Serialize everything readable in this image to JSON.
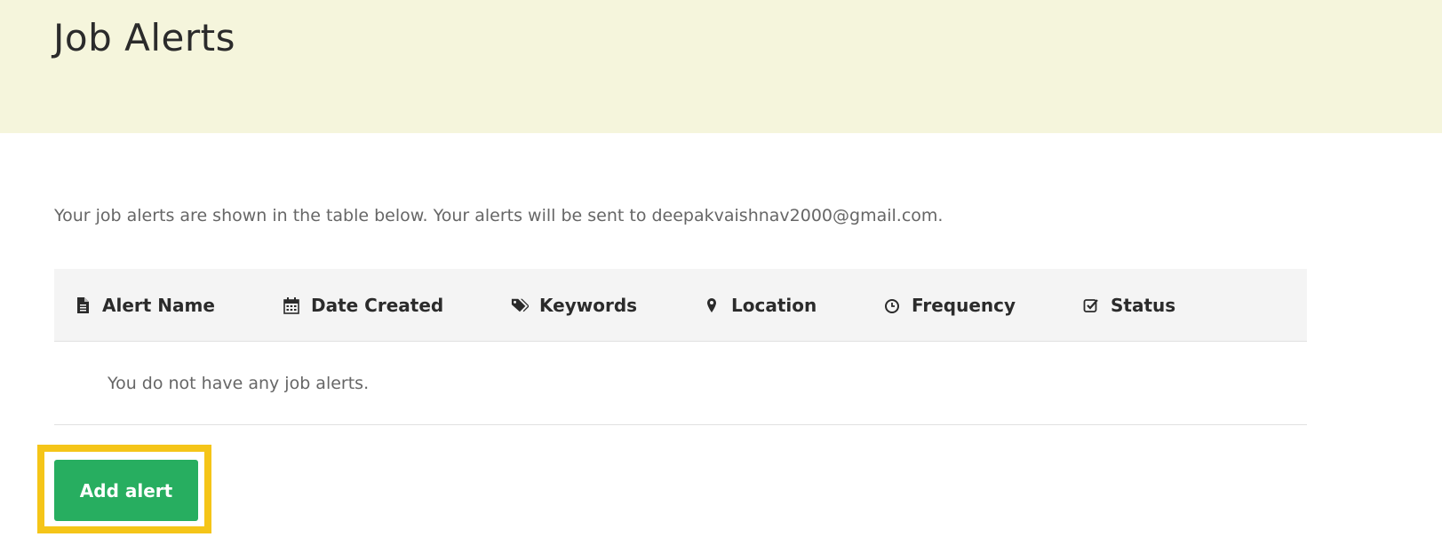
{
  "header": {
    "title": "Job Alerts",
    "background": "#f5f5dc"
  },
  "intro_text": "Your job alerts are shown in the table below. Your alerts will be sent to deepakvaishnav2000@gmail.com.",
  "table": {
    "columns": [
      {
        "label": "Alert Name",
        "icon": "file-text-icon"
      },
      {
        "label": "Date Created",
        "icon": "calendar-icon"
      },
      {
        "label": "Keywords",
        "icon": "tags-icon"
      },
      {
        "label": "Location",
        "icon": "map-pin-icon"
      },
      {
        "label": "Frequency",
        "icon": "clock-icon"
      },
      {
        "label": "Status",
        "icon": "checkbox-icon"
      }
    ],
    "empty_message": "You do not have any job alerts."
  },
  "add_button": {
    "label": "Add alert",
    "color": "#27ae60"
  },
  "highlight_color": "#f5c518"
}
